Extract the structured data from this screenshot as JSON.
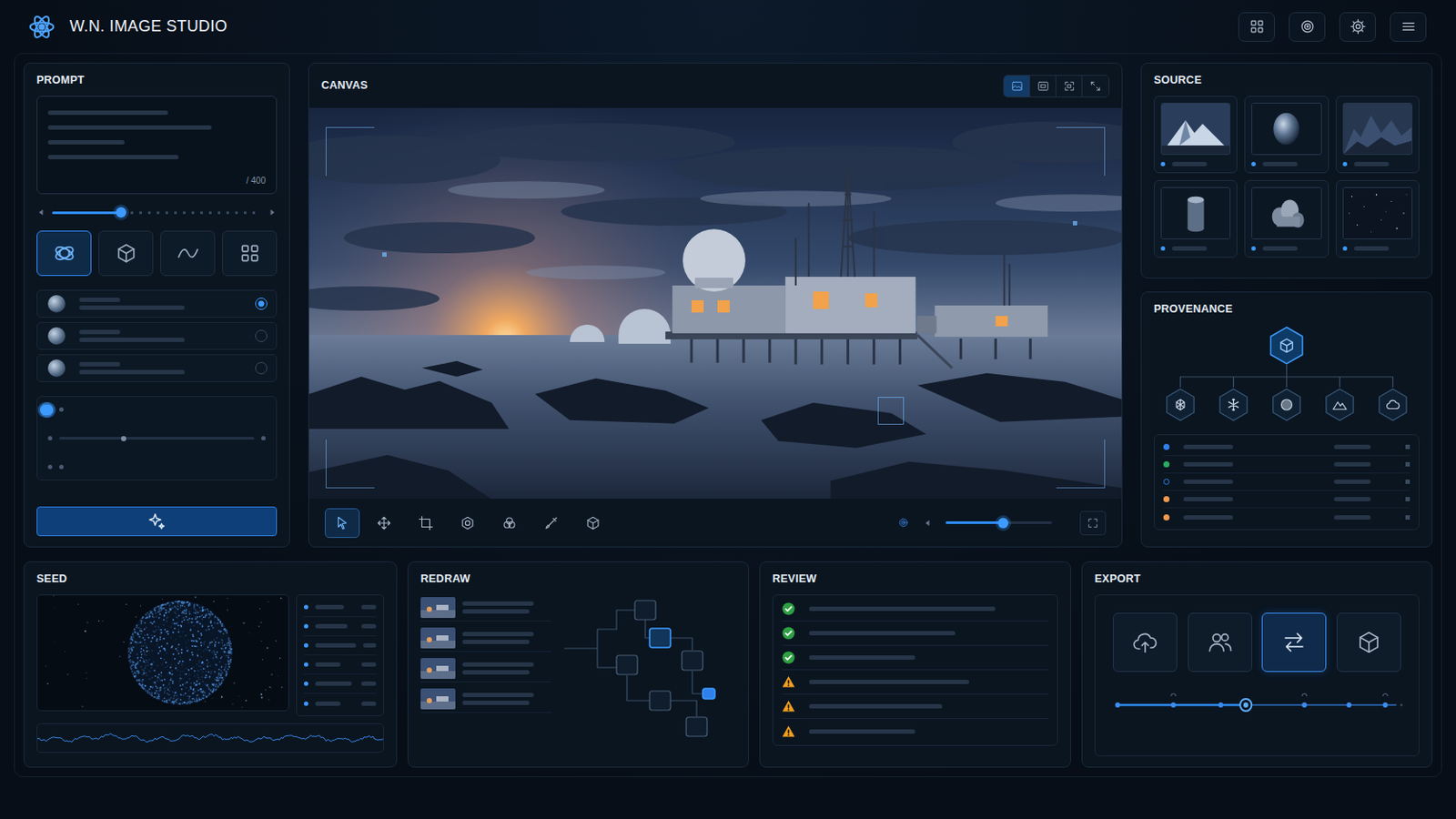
{
  "app": {
    "title": "W.N. IMAGE STUDIO",
    "header_buttons": [
      {
        "kind": "grid"
      },
      {
        "kind": "target"
      },
      {
        "kind": "gear"
      },
      {
        "kind": "menu"
      }
    ]
  },
  "prompt": {
    "title": "PROMPT",
    "counter": "/ 400",
    "strength": {
      "level": 0.33
    },
    "modes": [
      {
        "kind": "orbit",
        "selected": true
      },
      {
        "kind": "cube",
        "selected": false
      },
      {
        "kind": "curve",
        "selected": false
      },
      {
        "kind": "grid",
        "selected": false
      }
    ],
    "models": [
      {
        "selected": true
      },
      {
        "selected": false
      },
      {
        "selected": false
      }
    ],
    "sliders": [
      {
        "kind": "thumb",
        "level": 0.24
      },
      {
        "kind": "dot",
        "level": 0.33
      },
      {
        "kind": "thumb",
        "level": 0.31
      }
    ]
  },
  "canvas": {
    "title": "CANVAS",
    "views": [
      {
        "kind": "image",
        "selected": true
      },
      {
        "kind": "frame",
        "selected": false
      },
      {
        "kind": "focus",
        "selected": false
      },
      {
        "kind": "expand",
        "selected": false
      }
    ],
    "tools": [
      {
        "kind": "pointer",
        "selected": true
      },
      {
        "kind": "move",
        "selected": false
      },
      {
        "kind": "crop",
        "selected": false
      },
      {
        "kind": "mask",
        "selected": false
      },
      {
        "kind": "blend",
        "selected": false
      },
      {
        "kind": "brush",
        "selected": false
      },
      {
        "kind": "cube",
        "selected": false
      }
    ],
    "zoom": {
      "level": 0.54
    }
  },
  "source": {
    "title": "SOURCE",
    "items": [
      {
        "kind": "mountains"
      },
      {
        "kind": "sphere"
      },
      {
        "kind": "terrain"
      },
      {
        "kind": "cylinder"
      },
      {
        "kind": "cloud"
      },
      {
        "kind": "stars"
      }
    ]
  },
  "provenance": {
    "title": "PROVENANCE",
    "root": {
      "kind": "cube",
      "selected": true
    },
    "nodes": [
      {
        "kind": "crystal"
      },
      {
        "kind": "snowflake"
      },
      {
        "kind": "sphere"
      },
      {
        "kind": "mountains"
      },
      {
        "kind": "cloud"
      }
    ],
    "rows": [
      {
        "color": "#2f80ed",
        "filled": true
      },
      {
        "color": "#27ae60",
        "filled": true
      },
      {
        "color": "#2f80ed",
        "filled": false
      },
      {
        "color": "#f2994a",
        "filled": true
      },
      {
        "color": "#f2994a",
        "filled": true
      }
    ]
  },
  "seed": {
    "title": "SEED"
  },
  "redraw": {
    "title": "REDRAW",
    "graph": [
      {
        "selected": false
      },
      {
        "selected": true
      },
      {
        "selected": false
      },
      {
        "selected": false
      },
      {
        "selected": true
      },
      {
        "selected": false
      },
      {
        "selected": false
      }
    ]
  },
  "review": {
    "title": "REVIEW",
    "checks": [
      {
        "kind": "pass"
      },
      {
        "kind": "pass"
      },
      {
        "kind": "pass"
      },
      {
        "kind": "warn"
      },
      {
        "kind": "warn"
      },
      {
        "kind": "warn"
      }
    ]
  },
  "export": {
    "title": "EXPORT",
    "targets": [
      {
        "kind": "upload",
        "selected": false
      },
      {
        "kind": "users",
        "selected": false
      },
      {
        "kind": "swap",
        "selected": true
      },
      {
        "kind": "cube",
        "selected": false
      }
    ],
    "timeline": {
      "level": 0.46
    }
  }
}
